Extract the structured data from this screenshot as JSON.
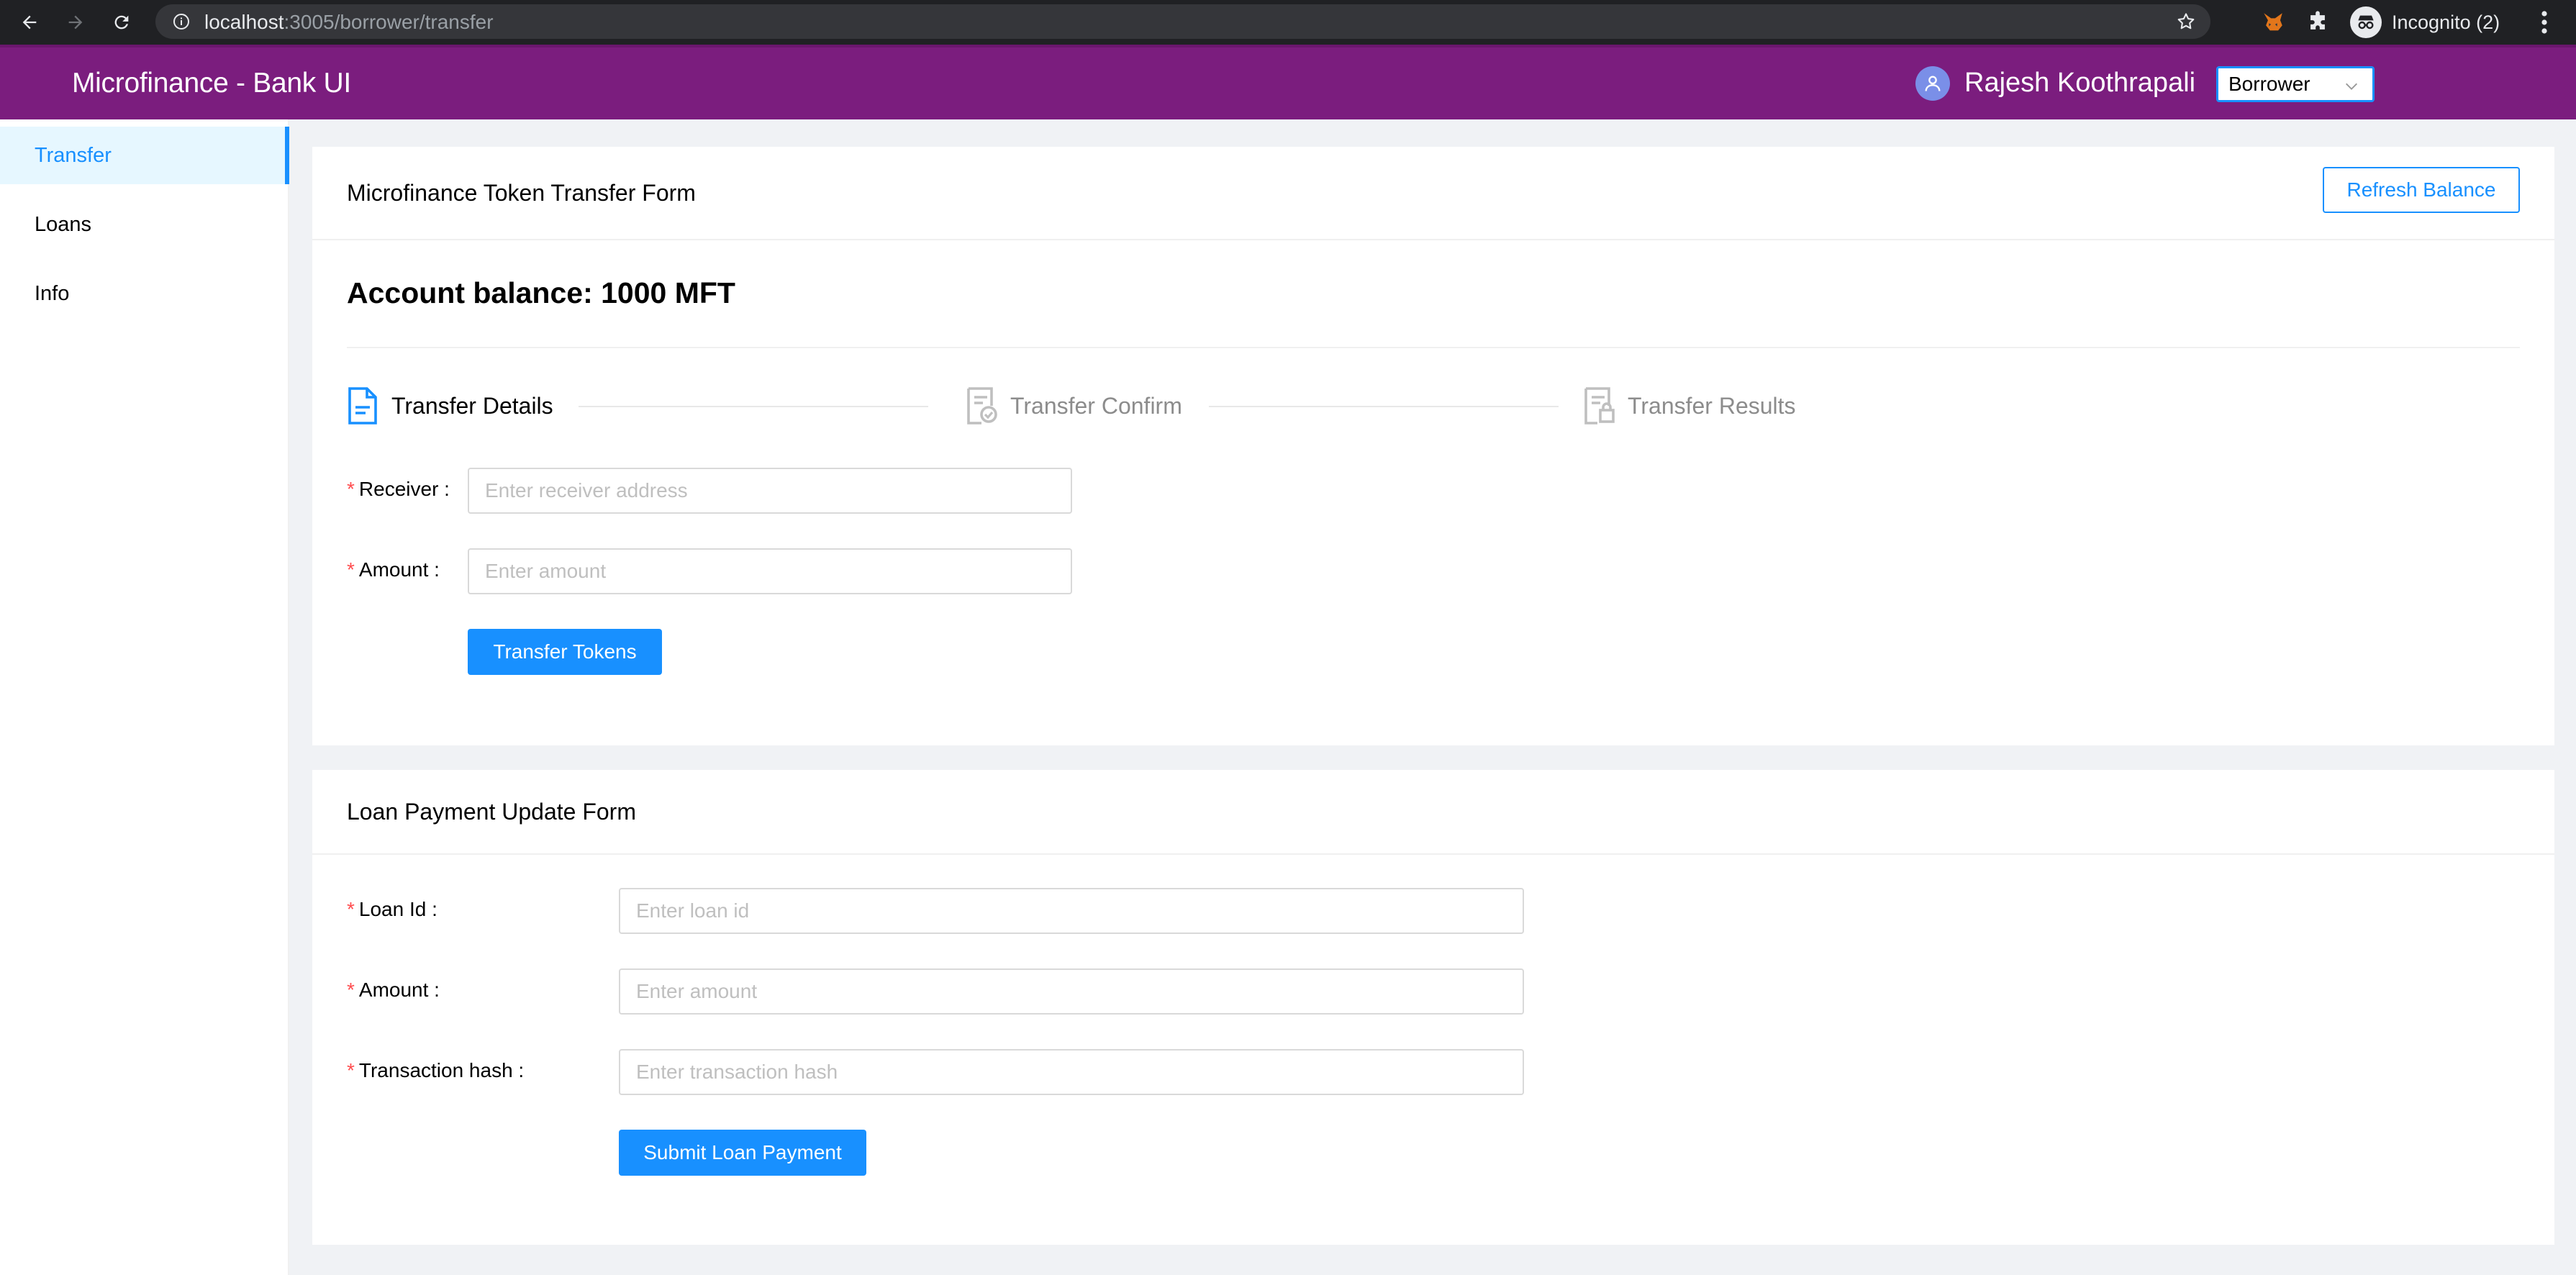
{
  "browser": {
    "url_host": "localhost",
    "url_path": ":3005/borrower/transfer",
    "profile_label": "Incognito (2)"
  },
  "header": {
    "title": "Microfinance - Bank UI",
    "user_name": "Rajesh Koothrapali",
    "role_selected": "Borrower"
  },
  "sidebar": {
    "items": [
      {
        "label": "Transfer",
        "active": true
      },
      {
        "label": "Loans",
        "active": false
      },
      {
        "label": "Info",
        "active": false
      }
    ]
  },
  "transfer_card": {
    "title": "Microfinance Token Transfer Form",
    "refresh_label": "Refresh Balance",
    "balance_text": "Account balance: 1000 MFT",
    "steps": [
      {
        "label": "Transfer Details",
        "state": "current"
      },
      {
        "label": "Transfer Confirm",
        "state": "waiting"
      },
      {
        "label": "Transfer Results",
        "state": "waiting"
      }
    ],
    "receiver": {
      "label": "Receiver",
      "placeholder": "Enter receiver address",
      "value": ""
    },
    "amount": {
      "label": "Amount",
      "placeholder": "Enter amount",
      "value": ""
    },
    "submit_label": "Transfer Tokens"
  },
  "loan_card": {
    "title": "Loan Payment Update Form",
    "loan_id": {
      "label": "Loan Id",
      "placeholder": "Enter loan id",
      "value": ""
    },
    "amount": {
      "label": "Amount",
      "placeholder": "Enter amount",
      "value": ""
    },
    "tx_hash": {
      "label": "Transaction hash",
      "placeholder": "Enter transaction hash",
      "value": ""
    },
    "submit_label": "Submit Loan Payment"
  },
  "colors": {
    "header_bg": "#7b1d7e",
    "primary": "#1890ff",
    "required": "#ff4d4f"
  }
}
